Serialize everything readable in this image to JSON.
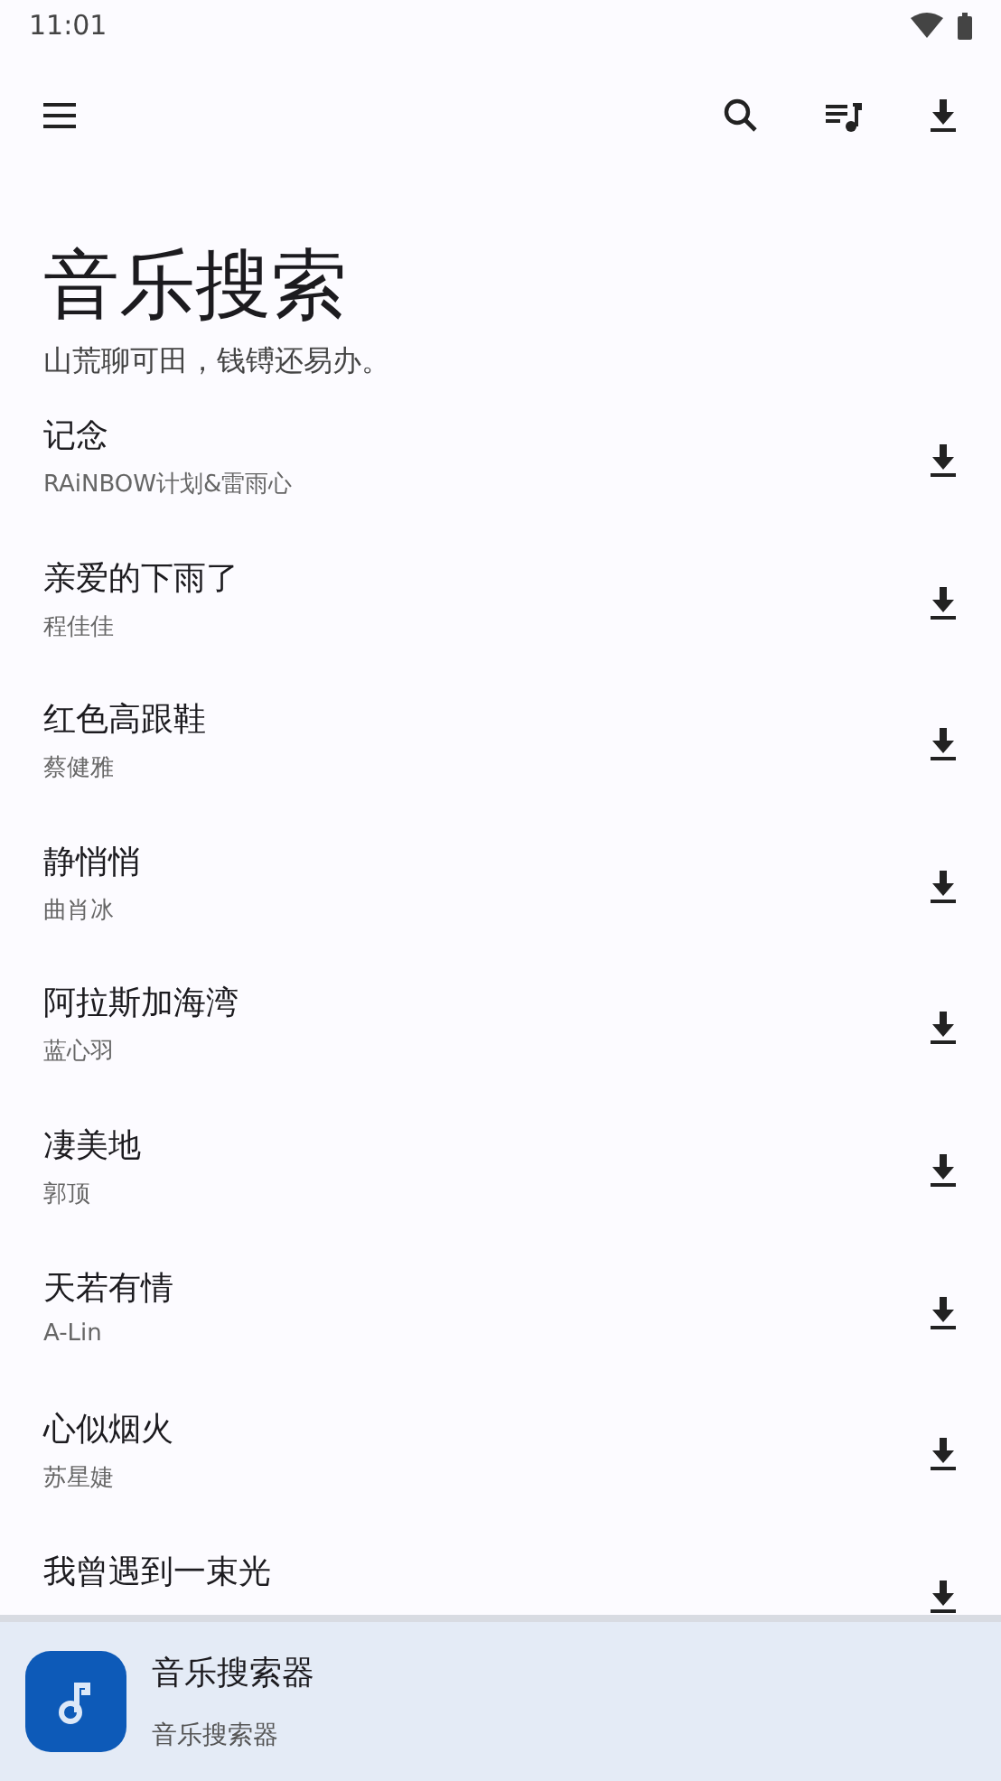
{
  "status_bar": {
    "time": "11:01"
  },
  "header": {
    "title": "音乐搜索",
    "subtitle": "山荒聊可田，钱镈还易办。"
  },
  "songs": [
    {
      "title": "记念",
      "artist": "RAiNBOW计划&雷雨心"
    },
    {
      "title": "亲爱的下雨了",
      "artist": "程佳佳"
    },
    {
      "title": "红色高跟鞋",
      "artist": "蔡健雅"
    },
    {
      "title": "静悄悄",
      "artist": "曲肖冰"
    },
    {
      "title": "阿拉斯加海湾",
      "artist": "蓝心羽"
    },
    {
      "title": "凄美地",
      "artist": "郭顶"
    },
    {
      "title": "天若有情",
      "artist": "A-Lin"
    },
    {
      "title": "心似烟火",
      "artist": "苏星婕"
    },
    {
      "title": "我曾遇到一束光"
    }
  ],
  "player": {
    "title": "音乐搜索器",
    "subtitle": "音乐搜索器"
  }
}
